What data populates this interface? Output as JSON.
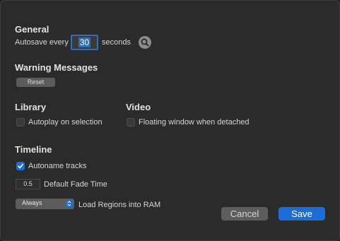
{
  "general": {
    "heading": "General",
    "autosave_prefix": "Autosave every",
    "autosave_value": "30",
    "autosave_suffix": "seconds",
    "search_icon": "magnifying-glass-icon"
  },
  "warning_messages": {
    "heading": "Warning Messages",
    "reset_label": "Reset"
  },
  "library": {
    "heading": "Library",
    "autoplay_label": "Autoplay on selection",
    "autoplay_checked": false
  },
  "video": {
    "heading": "Video",
    "floating_label": "Floating window when detached",
    "floating_checked": false
  },
  "timeline": {
    "heading": "Timeline",
    "autoname_label": "Autoname tracks",
    "autoname_checked": true,
    "fade_value": "0.5",
    "fade_label": "Default Fade Time",
    "load_option": "Always",
    "load_label": "Load Regions into RAM"
  },
  "footer": {
    "cancel_label": "Cancel",
    "save_label": "Save"
  },
  "colors": {
    "accent": "#1c6ed6",
    "background": "#2b2b2b"
  }
}
